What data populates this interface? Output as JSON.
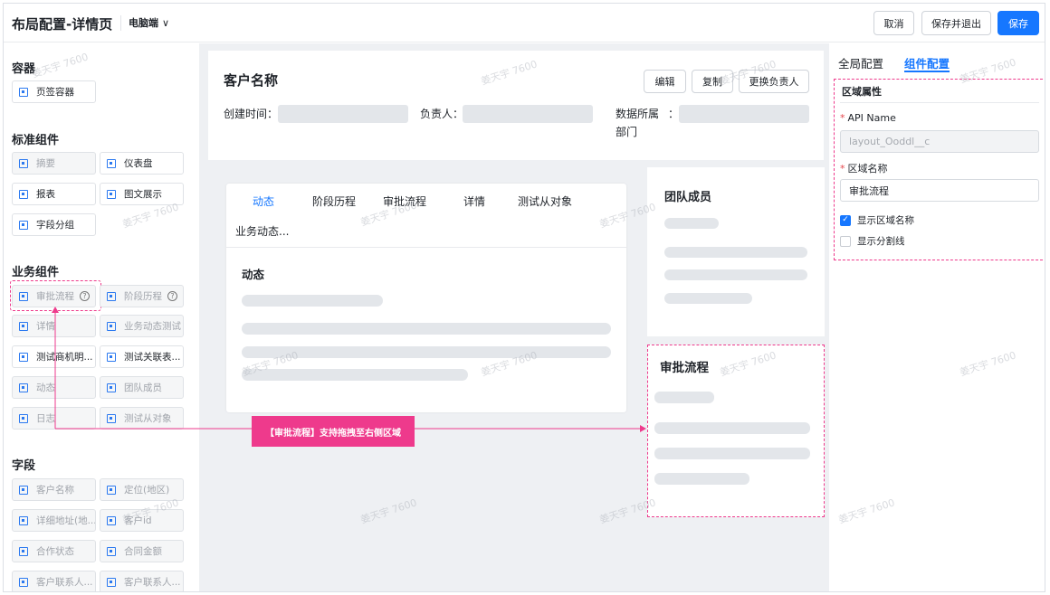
{
  "topbar": {
    "title": "布局配置-详情页",
    "device": "电脑端",
    "cancel": "取消",
    "save_exit": "保存并退出",
    "save": "保存"
  },
  "left": {
    "containers_title": "容器",
    "containers": [
      {
        "label": "页签容器",
        "disabled": false
      }
    ],
    "standard_title": "标准组件",
    "standard": [
      {
        "label": "摘要",
        "disabled": true
      },
      {
        "label": "仪表盘",
        "disabled": false
      },
      {
        "label": "报表",
        "disabled": false
      },
      {
        "label": "图文展示",
        "disabled": false
      },
      {
        "label": "字段分组",
        "disabled": false
      }
    ],
    "business_title": "业务组件",
    "business": [
      {
        "label": "审批流程",
        "disabled": true,
        "help": true
      },
      {
        "label": "阶段历程",
        "disabled": true,
        "help": true
      },
      {
        "label": "详情",
        "disabled": true
      },
      {
        "label": "业务动态测试",
        "disabled": true
      },
      {
        "label": "测试商机明...",
        "disabled": false
      },
      {
        "label": "测试关联表...",
        "disabled": false
      },
      {
        "label": "动态",
        "disabled": true
      },
      {
        "label": "团队成员",
        "disabled": true
      },
      {
        "label": "日志",
        "disabled": true
      },
      {
        "label": "测试从对象",
        "disabled": true
      }
    ],
    "fields_title": "字段",
    "fields": [
      {
        "label": "客户名称",
        "disabled": true
      },
      {
        "label": "定位(地区)",
        "disabled": true
      },
      {
        "label": "详细地址(地...",
        "disabled": true
      },
      {
        "label": "客户id",
        "disabled": true
      },
      {
        "label": "合作状态",
        "disabled": true
      },
      {
        "label": "合同金额",
        "disabled": true
      },
      {
        "label": "客户联系人...",
        "disabled": true
      },
      {
        "label": "客户联系人...",
        "disabled": true
      }
    ]
  },
  "center": {
    "customer_name": "客户名称",
    "edit": "编辑",
    "copy": "复制",
    "change_owner": "更换负责人",
    "created_label": "创建时间：",
    "owner_label": "负责人：",
    "dept_label_1": "数据所属",
    "dept_colon": "：",
    "dept_label_2": "部门",
    "tabs": [
      "动态",
      "阶段历程",
      "审批流程",
      "详情",
      "测试从对象",
      "业务动态..."
    ],
    "tab_content_title": "动态",
    "team_title": "团队成员",
    "approval_title": "审批流程"
  },
  "drag_hint": "【审批流程】支持拖拽至右侧区域",
  "right": {
    "tab_global": "全局配置",
    "tab_component": "组件配置",
    "region_title": "区域属性",
    "api_label": "API Name",
    "api_value": "layout_Ooddl__c",
    "name_label": "区域名称",
    "name_value": "审批流程",
    "show_name": "显示区域名称",
    "show_name_checked": true,
    "show_divider": "显示分割线",
    "show_divider_checked": false
  },
  "watermark": "姜天宇 7600",
  "colors": {
    "primary": "#1677ff",
    "highlight": "#ee3a8c"
  }
}
